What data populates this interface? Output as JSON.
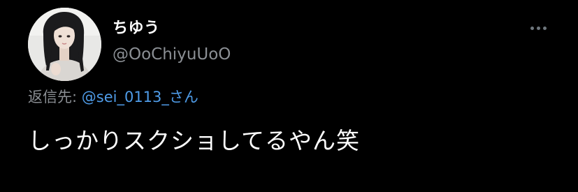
{
  "tweet": {
    "display_name": "ちゆう",
    "handle": "@OoChiyuUoO",
    "more_icon": "more-horizontal-icon",
    "reply_label": "返信先:",
    "reply_mention": "@sei_0113_さん",
    "text": "しっかりスクショしてるやん笑"
  },
  "colors": {
    "background": "#000000",
    "name": "#ffffff",
    "secondary": "#8b8f94",
    "link": "#4f9ce8"
  }
}
